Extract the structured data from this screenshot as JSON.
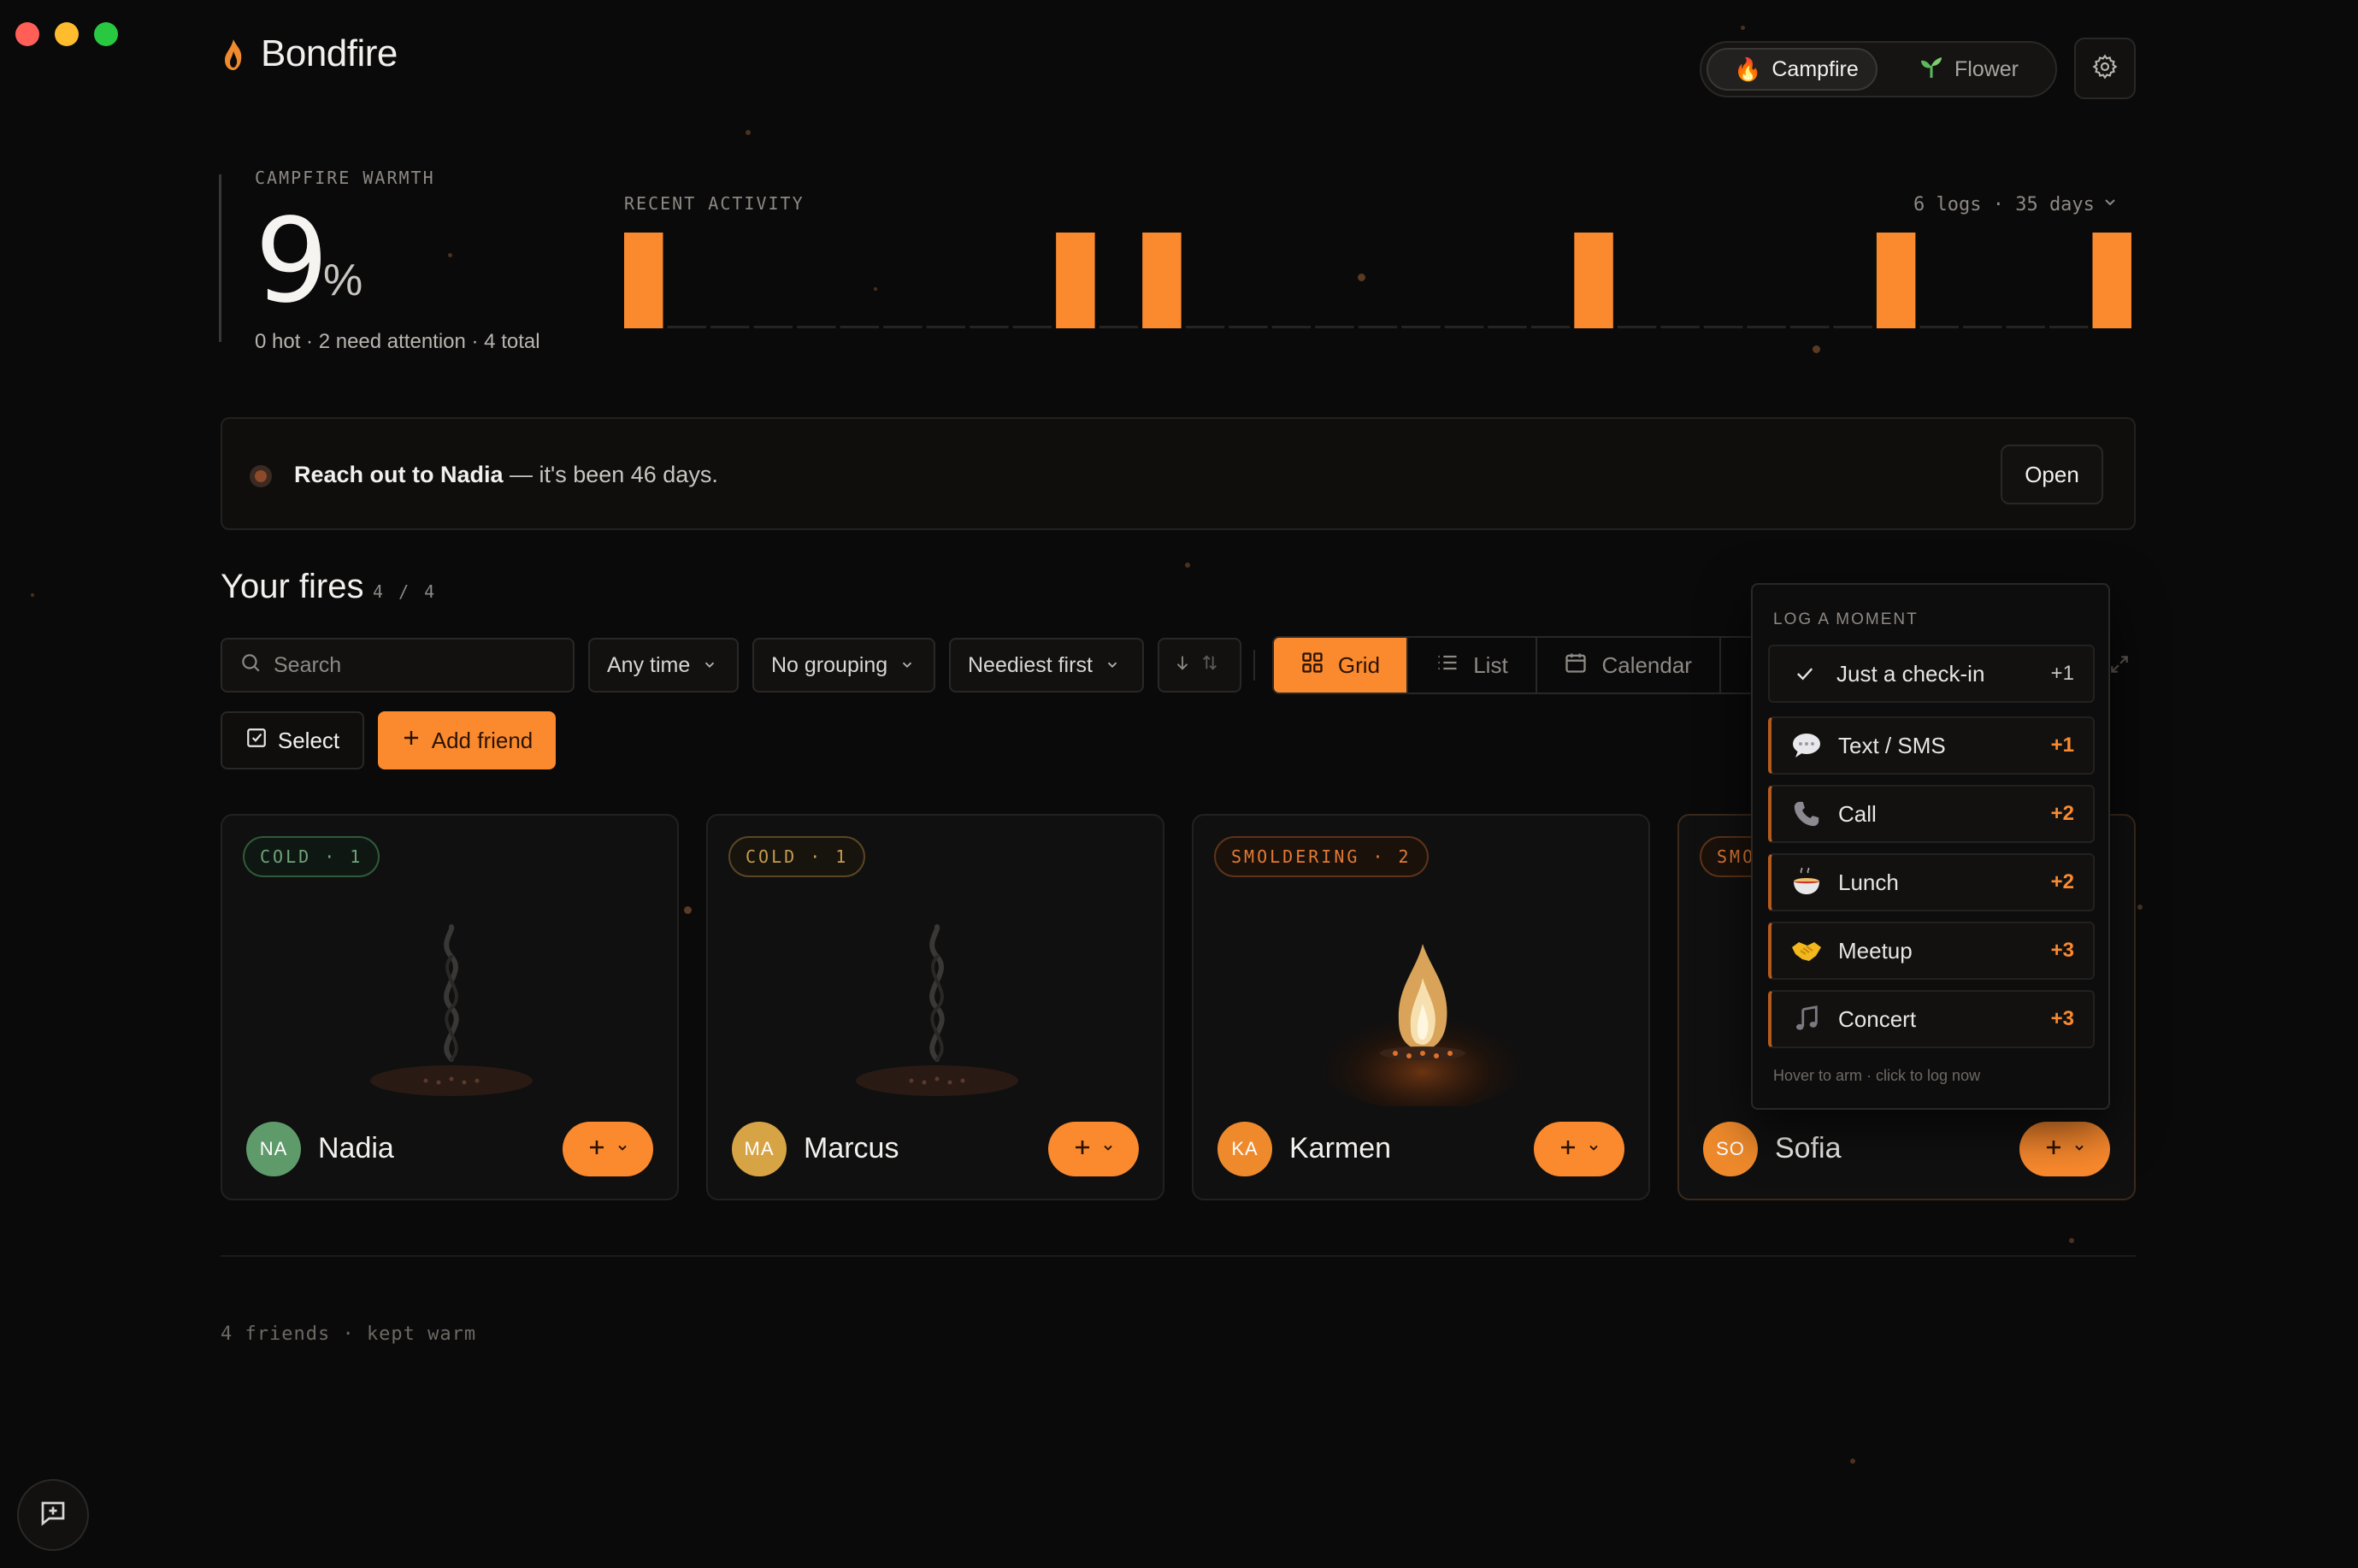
{
  "app": {
    "name": "Bondfire"
  },
  "mode_toggle": {
    "options": [
      {
        "label": "Campfire",
        "icon": "fire-icon",
        "active": true
      },
      {
        "label": "Flower",
        "icon": "sprout-icon",
        "active": false
      }
    ]
  },
  "warmth": {
    "label": "CAMPFIRE WARMTH",
    "value": "9",
    "unit": "%",
    "summary": "0 hot · 2 need attention · 4 total"
  },
  "activity": {
    "label": "RECENT ACTIVITY",
    "meta": "6 logs · 35 days",
    "accent": "#fb8a2e",
    "days": [
      1,
      0,
      0,
      0,
      0,
      0,
      0,
      0,
      0,
      0,
      1,
      0,
      1,
      0,
      0,
      0,
      0,
      0,
      0,
      0,
      0,
      0,
      1,
      0,
      0,
      0,
      0,
      0,
      0,
      1,
      0,
      0,
      0,
      0,
      1
    ]
  },
  "alert": {
    "strong": "Reach out to Nadia",
    "rest": " — it's been 46 days.",
    "action": "Open"
  },
  "fires": {
    "title": "Your fires",
    "count": "4 / 4"
  },
  "toolbar": {
    "search_placeholder": "Search",
    "time_filter": "Any time",
    "grouping": "No grouping",
    "sort": "Neediest first",
    "views": [
      "Grid",
      "List",
      "Calendar"
    ],
    "active_view": "Grid",
    "select_label": "Select",
    "add_label": "Add friend"
  },
  "cards": [
    {
      "status": "COLD · 1",
      "name": "Nadia",
      "initials": "NA",
      "avatar_color": "#5f9a6a",
      "state": "cold"
    },
    {
      "status": "COLD · 1",
      "name": "Marcus",
      "initials": "MA",
      "avatar_color": "#d7a445",
      "state": "cold"
    },
    {
      "status": "SMOLDERING · 2",
      "name": "Karmen",
      "initials": "KA",
      "avatar_color": "#ef8a2c",
      "state": "burning"
    },
    {
      "status": "SMO",
      "name": "Sofia",
      "initials": "SO",
      "avatar_color": "#ef8a2c",
      "state": "hidden"
    }
  ],
  "log_popup": {
    "title": "LOG A MOMENT",
    "items": [
      {
        "label": "Just a check-in",
        "points": "+1",
        "icon": "check-icon"
      },
      {
        "label": "Text / SMS",
        "points": "+1",
        "icon": "speech-bubble-icon"
      },
      {
        "label": "Call",
        "points": "+2",
        "icon": "phone-icon"
      },
      {
        "label": "Lunch",
        "points": "+2",
        "icon": "bowl-icon"
      },
      {
        "label": "Meetup",
        "points": "+3",
        "icon": "handshake-icon"
      },
      {
        "label": "Concert",
        "points": "+3",
        "icon": "music-icon"
      }
    ],
    "hint": "Hover to arm · click to log now"
  },
  "footer": {
    "text": "4 friends · kept warm"
  }
}
